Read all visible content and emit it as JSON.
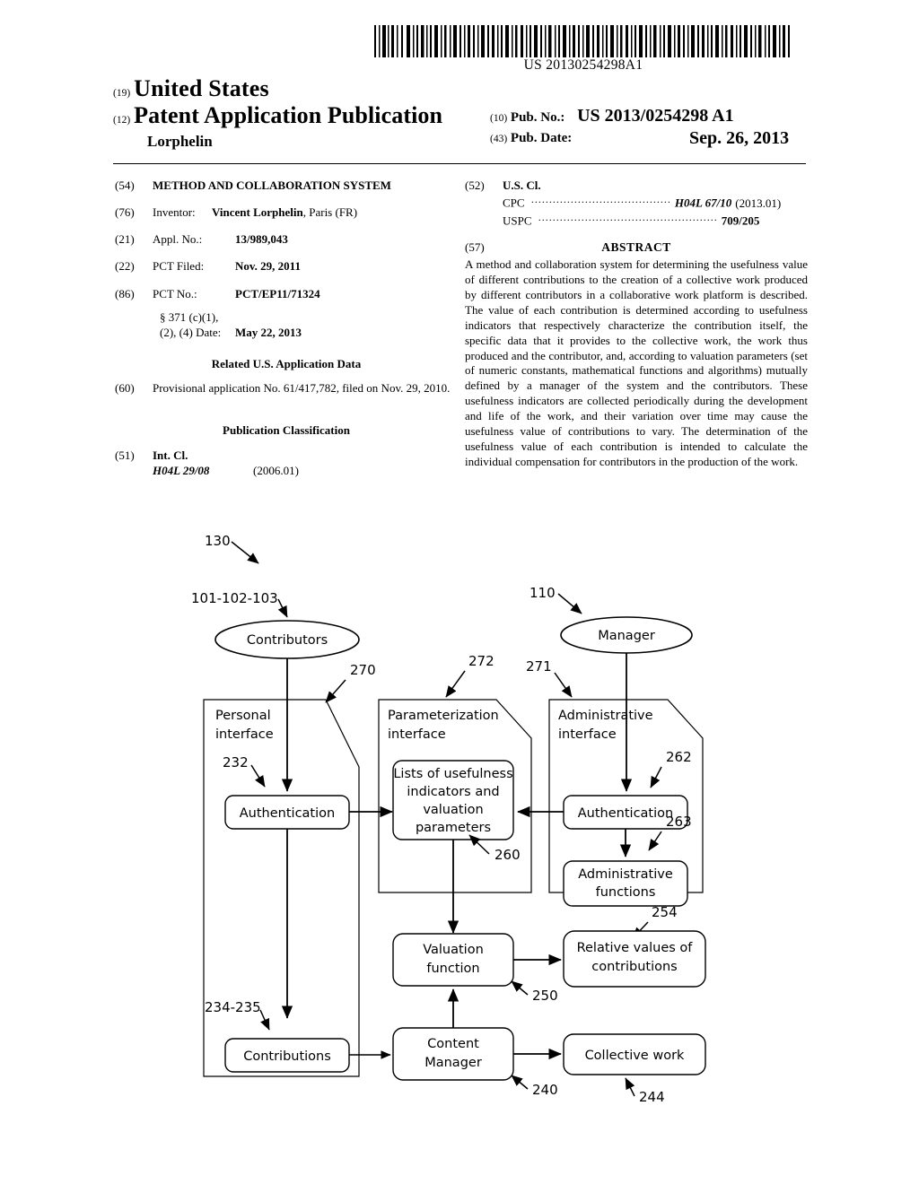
{
  "document": {
    "barcode_number": "US 20130254298A1",
    "masthead": {
      "code_19": "(19)",
      "country": "United States",
      "code_12": "(12)",
      "doc_type": "Patent Application Publication",
      "inventor_surname": "Lorphelin",
      "code_10": "(10)",
      "pubno_label": "Pub. No.:",
      "pubno_value": "US 2013/0254298 A1",
      "code_43": "(43)",
      "pubdate_label": "Pub. Date:",
      "pubdate_value": "Sep. 26, 2013"
    },
    "left_column": {
      "title": {
        "code": "(54)",
        "text": "METHOD AND COLLABORATION SYSTEM"
      },
      "inventor": {
        "code": "(76)",
        "label": "Inventor:",
        "name": "Vincent Lorphelin",
        "location": ", Paris (FR)"
      },
      "appl_no": {
        "code": "(21)",
        "label": "Appl. No.:",
        "value": "13/989,043"
      },
      "pct_filed": {
        "code": "(22)",
        "label": "PCT Filed:",
        "value": "Nov. 29, 2011"
      },
      "pct_no": {
        "code": "(86)",
        "label": "PCT No.:",
        "value": "PCT/EP11/71324"
      },
      "sec371": {
        "line1": "§ 371 (c)(1),",
        "line2_label": "(2), (4) Date:",
        "line2_value": "May 22, 2013"
      },
      "related_heading": "Related U.S. Application Data",
      "related": {
        "code": "(60)",
        "text": "Provisional application No. 61/417,782, filed on Nov. 29, 2010."
      },
      "pubclass_heading": "Publication Classification",
      "int_cl": {
        "code": "(51)",
        "label": "Int. Cl.",
        "symbol": "H04L 29/08",
        "version": "(2006.01)"
      }
    },
    "right_column": {
      "us_cl": {
        "code": "(52)",
        "label": "U.S. Cl.",
        "cpc_label": "CPC",
        "cpc_value": "H04L 67/10",
        "cpc_version": "(2013.01)",
        "uspc_label": "USPC",
        "uspc_value": "709/205"
      },
      "abstract": {
        "code": "(57)",
        "heading": "ABSTRACT",
        "text": "A method and collaboration system for determining the usefulness value of different contributions to the creation of a collective work produced by different contributors in a collaborative work platform is described. The value of each contribution is determined according to usefulness indicators that respectively characterize the contribution itself, the specific data that it provides to the collective work, the work thus produced and the contributor, and, according to valuation parameters (set of numeric constants, mathematical functions and algorithms) mutually defined by a manager of the system and the contributors. These usefulness indicators are collected periodically during the development and life of the work, and their variation over time may cause the usefulness value of contributions to vary. The determination of the usefulness value of each contribution is intended to calculate the individual compensation for contributors in the production of the work."
      }
    }
  },
  "figure": {
    "refs": {
      "r130": "130",
      "r101_103": "101-102-103",
      "r110": "110",
      "r270": "270",
      "r271": "271",
      "r272": "272",
      "r232": "232",
      "r234_235": "234-235",
      "r260": "260",
      "r262": "262",
      "r263": "263",
      "r240": "240",
      "r244": "244",
      "r250": "250",
      "r254": "254"
    },
    "nodes": {
      "contributors": "Contributors",
      "manager": "Manager",
      "personal_interface_l1": "Personal",
      "personal_interface_l2": "interface",
      "parameterization_l1": "Parameterization",
      "parameterization_l2": "interface",
      "administrative_l1": "Administrative",
      "administrative_l2": "interface",
      "auth_left": "Authentication",
      "auth_right": "Authentication",
      "admin_functions_l1": "Administrative",
      "admin_functions_l2": "functions",
      "lists_l1": "Lists of usefulness",
      "lists_l2": "indicators and",
      "lists_l3": "valuation",
      "lists_l4": "parameters",
      "contributions": "Contributions",
      "valuation_l1": "Valuation",
      "valuation_l2": "function",
      "content_l1": "Content",
      "content_l2": "Manager",
      "relative_l1": "Relative values of",
      "relative_l2": "contributions",
      "collective_work": "Collective work"
    }
  }
}
